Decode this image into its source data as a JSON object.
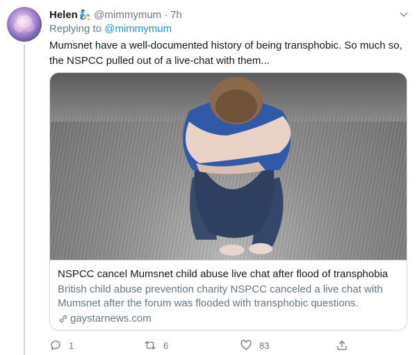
{
  "tweet": {
    "name": "Helen",
    "emoji": "🧞",
    "handle": "@mimmymum",
    "separator": "·",
    "time": "7h",
    "replying_prefix": "Replying to",
    "replying_to": "@mimmymum",
    "text_line1": "Mumsnet have a well-documented history of being transphobic. So much so,",
    "text_line2": "the NSPCC pulled out of a live-chat with them..."
  },
  "card": {
    "title": "NSPCC cancel Mumsnet child abuse live chat after flood of transphobia",
    "desc_line1": "British child abuse prevention charity NSPCC canceled a live chat with",
    "desc_line2": "Mumsnet after the forum was flooded with transphobic questions.",
    "domain": "gaystarnews.com"
  },
  "actions": {
    "reply_count": "1",
    "retweet_count": "6",
    "like_count": "83"
  },
  "icons": {
    "reply": "reply-icon",
    "retweet": "retweet-icon",
    "like": "heart-icon",
    "share": "share-icon",
    "more": "chevron-down-icon",
    "link": "link-icon"
  },
  "colors": {
    "accent": "#1b95e0",
    "secondary_text": "#657786",
    "border": "#ccd6dd"
  }
}
